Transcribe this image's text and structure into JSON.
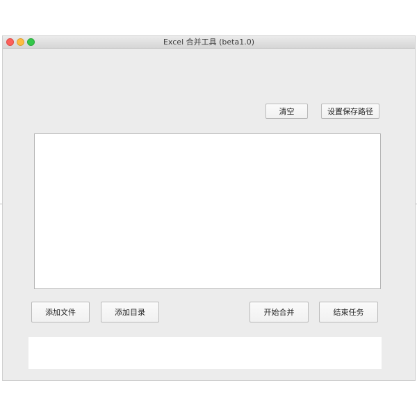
{
  "window": {
    "title": "Excel 合并工具 (beta1.0)"
  },
  "toolbar_top": {
    "clear_label": "清空",
    "set_save_path_label": "设置保存路径"
  },
  "file_list": {
    "items": []
  },
  "toolbar_bottom": {
    "add_file_label": "添加文件",
    "add_directory_label": "添加目录",
    "start_merge_label": "开始合并",
    "end_task_label": "结束任务"
  },
  "log_area": {
    "text": ""
  },
  "colors": {
    "window_background": "#ececec",
    "traffic_close": "#fc605b",
    "traffic_minimize": "#fdbc40",
    "traffic_maximize": "#34c84a"
  }
}
